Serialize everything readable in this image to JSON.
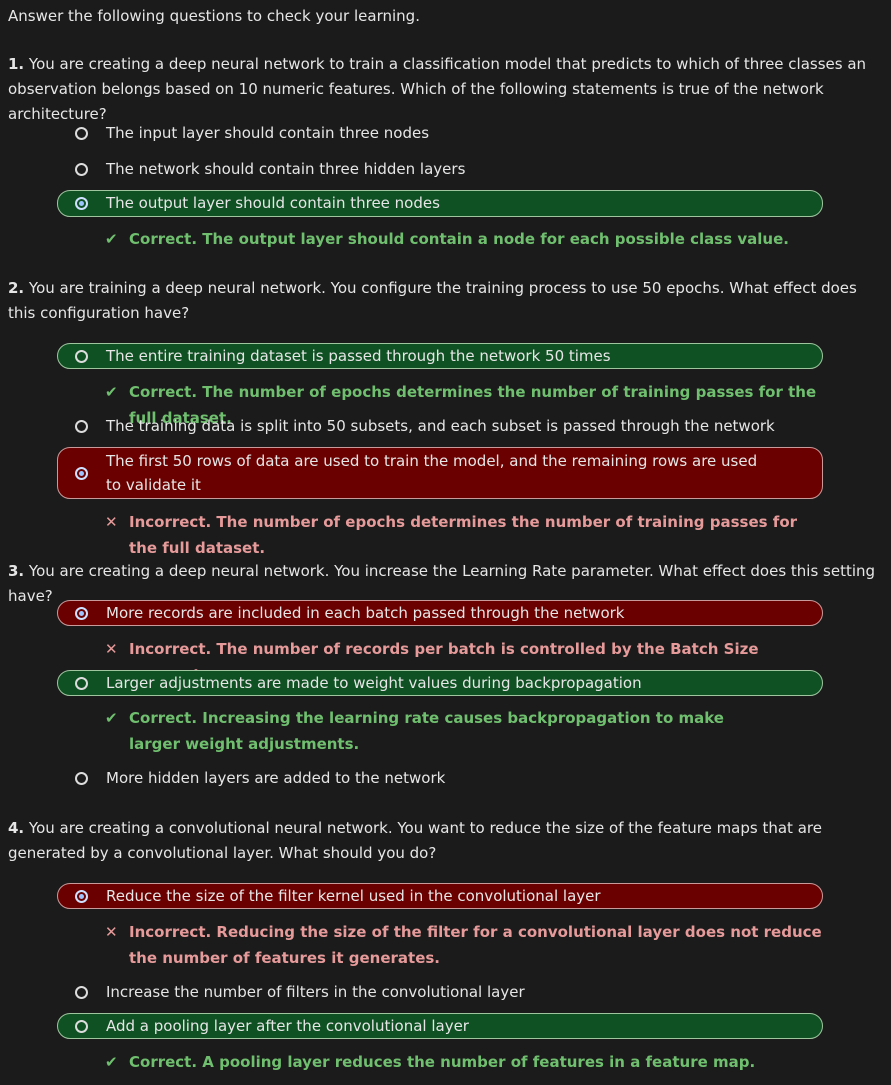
{
  "intro": "Answer the following questions to check your learning.",
  "questions": [
    {
      "num": "1.",
      "text": "You are creating a deep neural network to train a classification model that predicts to which of three classes an observation belongs based on 10 numeric features. Which of the following statements is true of the network architecture?",
      "options": [
        "The input layer should contain three nodes",
        "The network should contain three hidden layers",
        "The output layer should contain three nodes"
      ],
      "feedback": [
        {
          "icon": "✔",
          "text": "Correct. The output layer should contain a node for each possible class value."
        }
      ]
    },
    {
      "num": "2.",
      "text": "You are training a deep neural network. You configure the training process to use 50 epochs. What effect does this configuration have?",
      "options": [
        "The entire training dataset is passed through the network 50 times",
        "The training data is split into 50 subsets, and each subset is passed through the network",
        "The first 50 rows of data are used to train the model, and the remaining rows are used to validate it"
      ],
      "feedback": [
        {
          "icon": "✔",
          "text": "Correct. The number of epochs determines the number of training passes for the full dataset."
        },
        {
          "icon": "✕",
          "text": "Incorrect. The number of epochs determines the number of training passes for the full dataset."
        }
      ]
    },
    {
      "num": "3.",
      "text": "You are creating a deep neural network. You increase the Learning Rate parameter. What effect does this setting have?",
      "options": [
        "More records are included in each batch passed through the network",
        "Larger adjustments are made to weight values during backpropagation",
        "More hidden layers are added to the network"
      ],
      "feedback": [
        {
          "icon": "✕",
          "text": "Incorrect. The number of records per batch is controlled by the Batch Size parameter."
        },
        {
          "icon": "✔",
          "text": "Correct. Increasing the learning rate causes backpropagation to make larger weight adjustments."
        }
      ]
    },
    {
      "num": "4.",
      "text": "You are creating a convolutional neural network. You want to reduce the size of the feature maps that are generated by a convolutional layer. What should you do?",
      "options": [
        "Reduce the size of the filter kernel used in the convolutional layer",
        "Increase the number of filters in the convolutional layer",
        "Add a pooling layer after the convolutional layer"
      ],
      "feedback": [
        {
          "icon": "✕",
          "text": "Incorrect. Reducing the size of the filter for a convolutional layer does not reduce the number of features it generates."
        },
        {
          "icon": "✔",
          "text": "Correct. A pooling layer reduces the number of features in a feature map."
        }
      ]
    }
  ]
}
